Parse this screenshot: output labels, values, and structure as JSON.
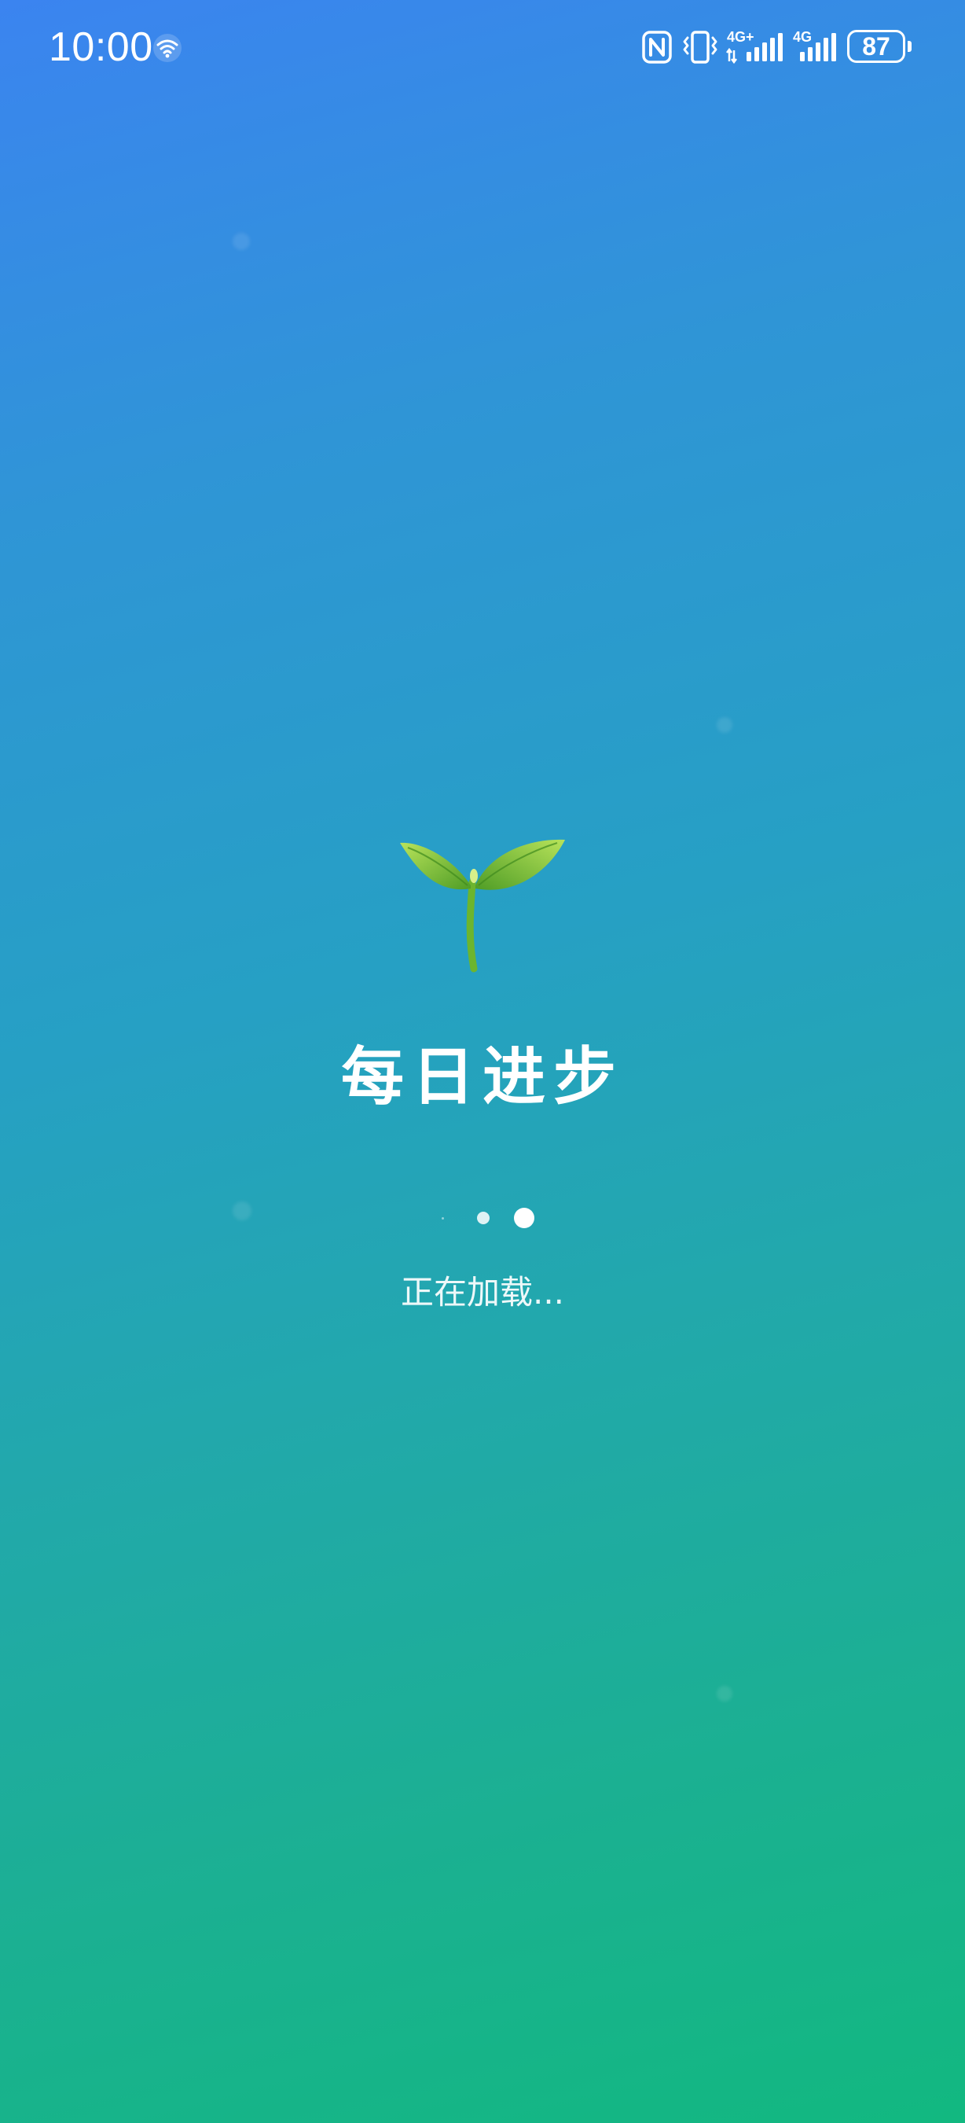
{
  "status_bar": {
    "time": "10:00",
    "battery_level": "87",
    "network_1": "4G+",
    "network_2": "4G",
    "icons": [
      "wifi-icon",
      "nfc-icon",
      "vibrate-icon",
      "signal-icon",
      "signal-icon",
      "battery-icon"
    ]
  },
  "splash": {
    "logo_icon": "sprout-icon",
    "title": "每日进步",
    "loading_text": "正在加载..."
  },
  "colors": {
    "gradient_top": "#3b84f0",
    "gradient_bottom": "#12b880",
    "text": "#ffffff",
    "leaf_green": "#7fc73a"
  }
}
